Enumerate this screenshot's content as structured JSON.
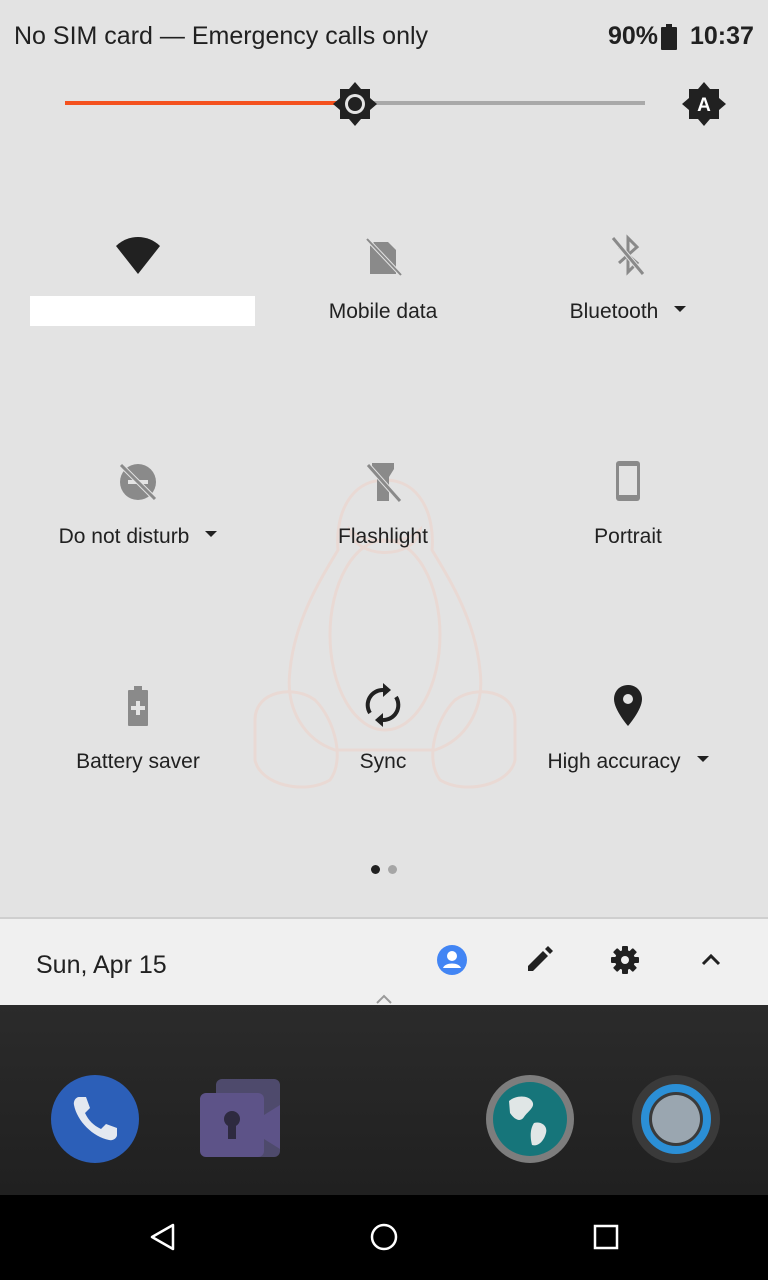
{
  "status_bar": {
    "carrier": "No SIM card — Emergency calls only",
    "battery_percent": "90%",
    "time": "10:37",
    "battery_icon": "battery-icon"
  },
  "brightness": {
    "level": 0.5,
    "fill_color": "#f4511e",
    "auto_icon": "brightness-auto-icon"
  },
  "tiles": [
    {
      "label": "",
      "icon": "wifi-icon",
      "dropdown": false
    },
    {
      "label": "Mobile data",
      "icon": "mobile-data-off-icon",
      "dropdown": false
    },
    {
      "label": "Bluetooth",
      "icon": "bluetooth-off-icon",
      "dropdown": true
    },
    {
      "label": "Do not disturb",
      "icon": "do-not-disturb-off-icon",
      "dropdown": true
    },
    {
      "label": "Flashlight",
      "icon": "flashlight-off-icon",
      "dropdown": false
    },
    {
      "label": "Portrait",
      "icon": "portrait-icon",
      "dropdown": false
    },
    {
      "label": "Battery saver",
      "icon": "battery-saver-icon",
      "dropdown": false
    },
    {
      "label": "Sync",
      "icon": "sync-icon",
      "dropdown": false
    },
    {
      "label": "High accuracy",
      "icon": "location-icon",
      "dropdown": true
    }
  ],
  "pager": {
    "pages": 2,
    "current": 1
  },
  "footer": {
    "date": "Sun, Apr 15",
    "user_icon": "user-icon",
    "edit_icon": "edit-icon",
    "settings_icon": "gear-icon",
    "collapse_icon": "chevron-up-icon",
    "accent_color": "#4285f4"
  },
  "dock": {
    "apps": [
      "phone-app-icon",
      "private-video-app-icon",
      "browser-globe-app-icon",
      "circle-app-icon"
    ]
  },
  "navbar": {
    "buttons": [
      "back-icon",
      "home-icon",
      "recents-icon"
    ]
  }
}
